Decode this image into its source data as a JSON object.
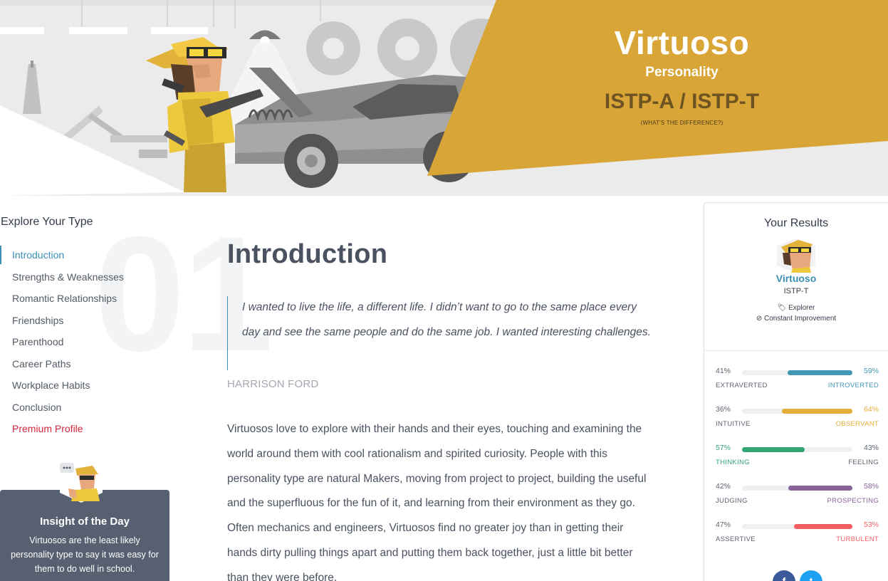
{
  "hero": {
    "name": "Virtuoso",
    "subtitle": "Personality",
    "codes": "ISTP-A / ISTP-T",
    "difference_link": "(WHAT'S THE DIFFERENCE?)",
    "accent_color": "#d8a536"
  },
  "sidebar": {
    "title": "Explore Your Type",
    "big_number": "01",
    "items": [
      {
        "label": "Introduction",
        "active": true
      },
      {
        "label": "Strengths & Weaknesses"
      },
      {
        "label": "Romantic Relationships"
      },
      {
        "label": "Friendships"
      },
      {
        "label": "Parenthood"
      },
      {
        "label": "Career Paths"
      },
      {
        "label": "Workplace Habits"
      },
      {
        "label": "Conclusion"
      },
      {
        "label": "Premium Profile",
        "premium": true
      }
    ],
    "insight": {
      "title": "Insight of the Day",
      "text": "Virtuosos are the least likely personality type to say it was easy for them to do well in school."
    }
  },
  "main": {
    "title": "Introduction",
    "quote": "I wanted to live the life, a different life. I didn’t want to go to the same place every day and see the same people and do the same job. I wanted interesting challenges.",
    "quote_author": "HARRISON FORD",
    "body": "Virtuosos love to explore with their hands and their eyes, touching and examining the world around them with cool rationalism and spirited curiosity. People with this personality type are natural Makers, moving from project to project, building the useful and the superfluous for the fun of it, and learning from their environment as they go. Often mechanics and engineers, Virtuosos find no greater joy than in getting their hands dirty pulling things apart and putting them back together, just a little bit better than they were before."
  },
  "results": {
    "title": "Your Results",
    "type": "Virtuoso",
    "code": "ISTP-T",
    "role": "Explorer",
    "strategy": "Constant Improvement",
    "traits": [
      {
        "left_pct": "41%",
        "right_pct": "59%",
        "left_label": "EXTRAVERTED",
        "right_label": "INTROVERTED",
        "dominant": "right",
        "value": 59,
        "color": "#4298b4"
      },
      {
        "left_pct": "36%",
        "right_pct": "64%",
        "left_label": "INTUITIVE",
        "right_label": "OBSERVANT",
        "dominant": "right",
        "value": 64,
        "color": "#e4ae3a"
      },
      {
        "left_pct": "57%",
        "right_pct": "43%",
        "left_label": "THINKING",
        "right_label": "FEELING",
        "dominant": "left",
        "value": 57,
        "color": "#33a474"
      },
      {
        "left_pct": "42%",
        "right_pct": "58%",
        "left_label": "JUDGING",
        "right_label": "PROSPECTING",
        "dominant": "right",
        "value": 58,
        "color": "#88619a"
      },
      {
        "left_pct": "47%",
        "right_pct": "53%",
        "left_label": "ASSERTIVE",
        "right_label": "TURBULENT",
        "dominant": "right",
        "value": 53,
        "color": "#f25e62"
      }
    ],
    "share": {
      "facebook": "f",
      "twitter": "t"
    }
  }
}
